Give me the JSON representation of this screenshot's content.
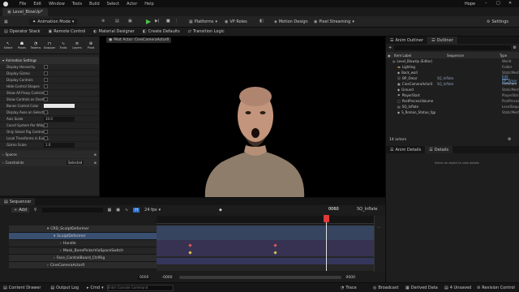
{
  "app": {
    "level_tab": "Level_BlowUp*",
    "user": "Hope",
    "menu": [
      "File",
      "Edit",
      "Window",
      "Tools",
      "Build",
      "Select",
      "Actor",
      "Help"
    ]
  },
  "toolbar": {
    "mode": "Animation Mode",
    "platforms": "Platforms",
    "vr_modes": "VP Roles",
    "motion_design": "Motion Design",
    "pixel_streaming": "Pixel Streaming",
    "settings": "Settings"
  },
  "subbar": {
    "items": [
      "Operator Stack",
      "Remote Control",
      "Material Designer",
      "Create Defaults",
      "Transition Logic"
    ]
  },
  "anim_tools": [
    "Select",
    "Poses",
    "Tweens",
    "Snapper",
    "Trails",
    "Layers",
    "Pivot"
  ],
  "anim_settings": {
    "header": "Animation Settings",
    "props": [
      "Display Hierarchy",
      "Display Gizmo",
      "Display Controls",
      "Hide Control Shapes",
      "Show All Proxy Controls",
      "Show Controls as Overlay",
      "Bones Control Color",
      "Display Axes on Selection",
      "Axis Scale",
      "Coord System Per Widget",
      "Only Select Rig Controls",
      "Local Transforms in Each...",
      "Gizmo Scale"
    ],
    "axis_scale": "10.0",
    "gizmo_scale": "1.0",
    "spaces": "Spaces",
    "constraints": "Constraints",
    "selected": "Selected"
  },
  "viewport": {
    "pilot_label": "Pilot Actor: CineCameraActor0"
  },
  "outliner": {
    "tab1": "Anim Outliner",
    "tab2": "Outliner",
    "col_label": "Item Label",
    "col_seq": "Sequencer",
    "col_type": "Type",
    "items": [
      {
        "label": "Level_BlowUp (Editor)",
        "type": "World"
      },
      {
        "label": "Lighting",
        "type": "Folder"
      },
      {
        "label": "Back_wall",
        "type": "StaticMesh"
      },
      {
        "label": "BP_Omar",
        "tag": "SQ_Inflate",
        "type": "Edit BP_Omar"
      },
      {
        "label": "CineCameraActor0",
        "tag": "SQ_Inflate",
        "type": "CineCam"
      },
      {
        "label": "Ground",
        "type": "StaticMesh"
      },
      {
        "label": "PlayerStart",
        "type": "PlayerStart"
      },
      {
        "label": "PostProcessVolume",
        "type": "PostProcess"
      },
      {
        "label": "SQ_Inflate",
        "type": "LevelSequence"
      },
      {
        "label": "S_Roman_Statue_fgp",
        "type": "StaticMesh"
      }
    ],
    "count": "14 actors"
  },
  "details": {
    "tab1": "Anim Details",
    "tab2": "Details",
    "empty": "Select an object to view details"
  },
  "sequencer": {
    "tab": "Sequencer",
    "add": "Add",
    "fps": "24 fps",
    "frame": "0060",
    "seq_name": "SQ_Inflate",
    "tracks": [
      "CRD_SculptDeformer",
      "SculptDeformer",
      "Handle",
      "Mask_BonePickerViaSpaceSwitch",
      "Face_ControlBoard_CtrlRig",
      "CineCameraActor0"
    ],
    "start": "0000",
    "end": "-0000",
    "mid": "0000"
  },
  "status": {
    "content_drawer": "Content Drawer",
    "output_log": "Output Log",
    "cmd": "Cmd",
    "cmd_placeholder": "Enter Console Command",
    "trace": "Trace",
    "broadcast": "Broadcast",
    "derived": "Derived Data",
    "unsaved": "4 Unsaved",
    "revision": "Revision Control"
  }
}
